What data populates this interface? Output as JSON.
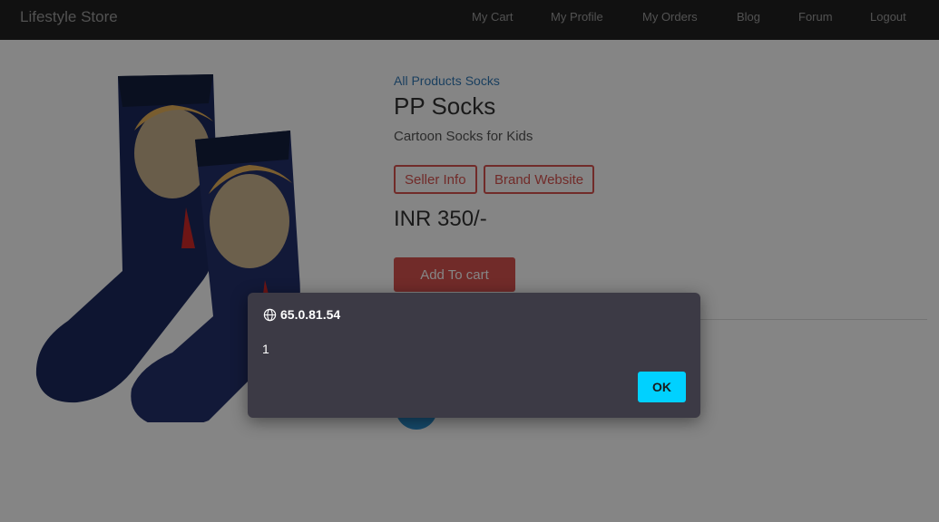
{
  "navbar": {
    "brand": "Lifestyle Store",
    "links": [
      "My Cart",
      "My Profile",
      "My Orders",
      "Blog",
      "Forum",
      "Logout"
    ]
  },
  "product": {
    "breadcrumb": [
      "All Products",
      "Socks"
    ],
    "title": "PP Socks",
    "subtitle": "Cartoon Socks for Kids",
    "seller_info_label": "Seller Info",
    "brand_website_label": "Brand Website",
    "price": "INR 350/-",
    "add_to_cart_label": "Add To cart",
    "image_icon": "socks-product-image"
  },
  "dialog": {
    "origin": "65.0.81.54",
    "message": "1",
    "ok_label": "OK",
    "icon": "globe-icon"
  },
  "colors": {
    "navbar_bg": "#222222",
    "link": "#337ab7",
    "danger": "#d9534f",
    "dialog_bg": "#3c3a45",
    "ok_button": "#00d1ff"
  }
}
